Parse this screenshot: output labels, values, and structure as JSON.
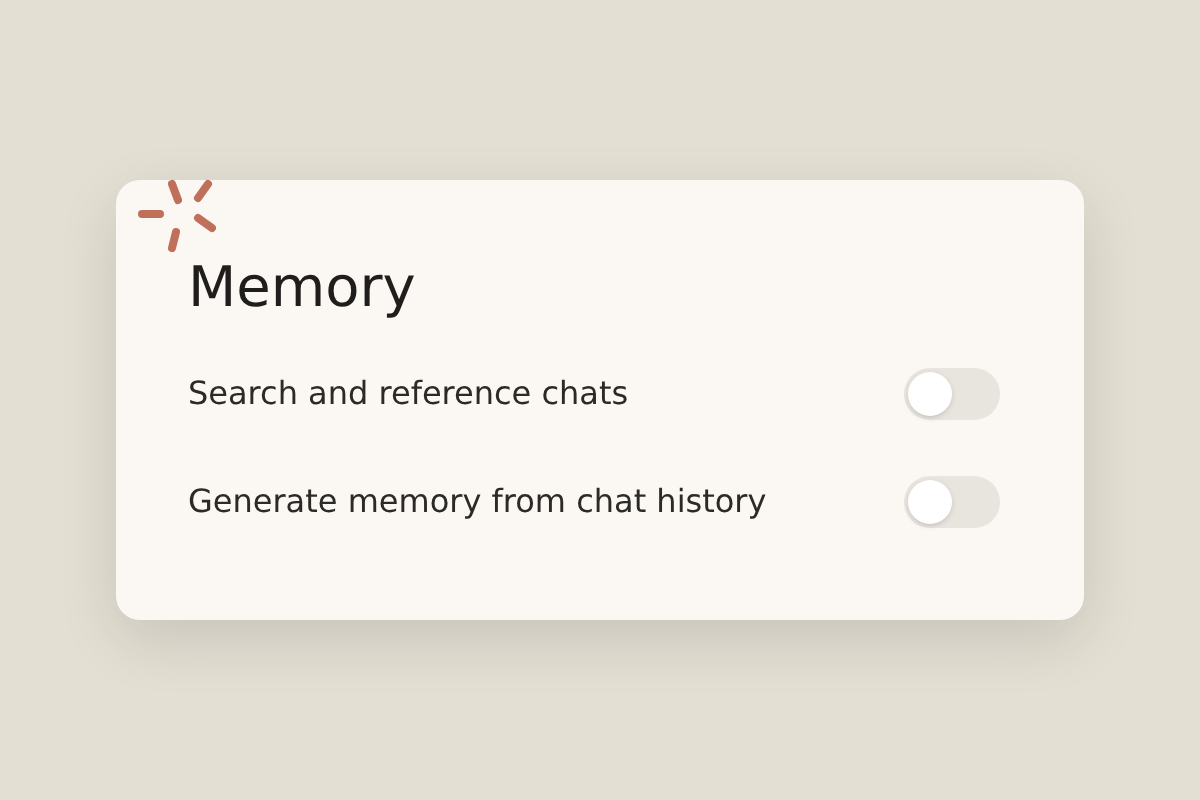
{
  "card": {
    "title": "Memory",
    "settings": [
      {
        "label": "Search and reference chats",
        "on": false
      },
      {
        "label": "Generate memory from chat history",
        "on": false
      }
    ]
  }
}
